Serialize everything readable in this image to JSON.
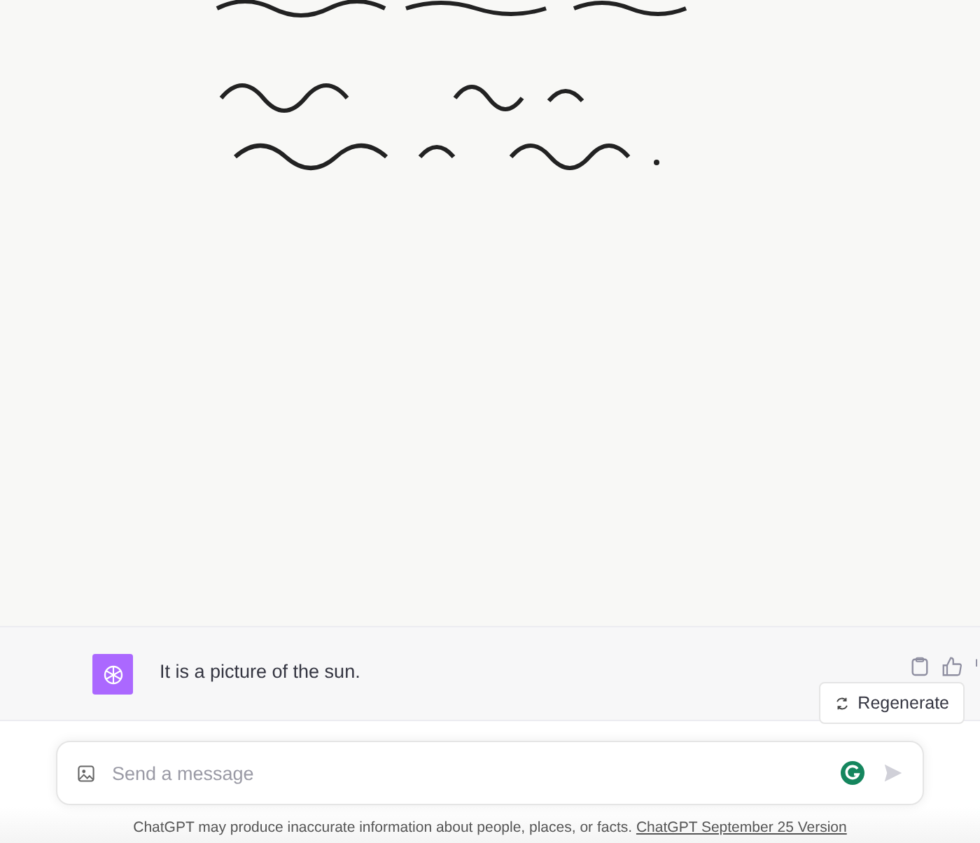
{
  "reply": {
    "text": "It is a picture of the sun.",
    "regenerate_label": "Regenerate"
  },
  "composer": {
    "placeholder": "Send a message"
  },
  "footer": {
    "text": "ChatGPT may produce inaccurate information about people, places, or facts.",
    "link": "ChatGPT September 25 Version"
  }
}
